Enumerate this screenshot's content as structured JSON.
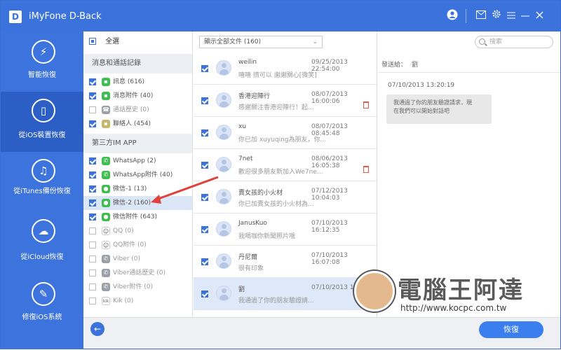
{
  "app": {
    "logo": "D",
    "title": "iMyFone D-Back"
  },
  "titlebar_icons": [
    "user-icon",
    "mail-icon",
    "gear-icon",
    "menu-icon",
    "minimize-icon",
    "close-icon"
  ],
  "sidebar": {
    "items": [
      {
        "label": "智能恢復",
        "icon": "smart-recover-icon",
        "glyph": "⚡"
      },
      {
        "label": "從iOS裝置恢復",
        "icon": "ios-device-icon",
        "glyph": "▯"
      },
      {
        "label": "從iTunes備份恢復",
        "icon": "itunes-icon",
        "glyph": "♫"
      },
      {
        "label": "從iCloud恢復",
        "icon": "icloud-icon",
        "glyph": "☁"
      },
      {
        "label": "修復iOS系統",
        "icon": "repair-icon",
        "glyph": "✎"
      }
    ]
  },
  "categories": {
    "all_label": "全選",
    "section1": "消息和通話記錄",
    "section2": "第三方IM APP",
    "items1": [
      {
        "label": "訊息 (616)",
        "icon": "messages-icon"
      },
      {
        "label": "消息附件 (40)",
        "icon": "message-attachment-icon"
      },
      {
        "label": "通話歷史 (0)",
        "icon": "call-history-icon"
      },
      {
        "label": "聯絡人 (454)",
        "icon": "contacts-icon"
      }
    ],
    "items2": [
      {
        "label": "WhatsApp (2)",
        "icon": "whatsapp-icon"
      },
      {
        "label": "WhatsApp附件 (40)",
        "icon": "whatsapp-attachment-icon"
      },
      {
        "label": "微信-1 (13)",
        "icon": "wechat-icon"
      },
      {
        "label": "微信-2 (160)",
        "icon": "wechat-icon"
      },
      {
        "label": "微信附件 (643)",
        "icon": "wechat-attachment-icon"
      },
      {
        "label": "QQ (0)",
        "icon": "qq-icon"
      },
      {
        "label": "QQ附件 (0)",
        "icon": "qq-attachment-icon"
      },
      {
        "label": "Viber (0)",
        "icon": "viber-icon"
      },
      {
        "label": "Viber通話歷史 (0)",
        "icon": "viber-call-icon"
      },
      {
        "label": "Viber附件 (0)",
        "icon": "viber-attachment-icon"
      },
      {
        "label": "Kik (0)",
        "icon": "kik-icon"
      }
    ]
  },
  "list": {
    "filter": "顯示全部文件 (160)",
    "messages": [
      {
        "name": "weilin",
        "time": "09/25/2013 22:54:00",
        "preview": "嘻嘻 擠可以 謝謝關心[微笑]",
        "trash": false
      },
      {
        "name": "香港迎陣行",
        "time": "08/07/2013 16:00:06",
        "preview": "感謝關注香港迎陣行！起...",
        "trash": true
      },
      {
        "name": "xu",
        "time": "08/07/2013 08:45:48",
        "preview": "你已加 xuyuqing為朋友，你...",
        "trash": false
      },
      {
        "name": "7net",
        "time": "08/06/2013 16:05:38",
        "preview": "歡迎很多朋友新加入We7ne...",
        "trash": true
      },
      {
        "name": "賣女孩的小火材",
        "time": "07/12/2013 10:04:03",
        "preview": "你已加賣女孩的小火材為...",
        "trash": false
      },
      {
        "name": "JanusKuo",
        "time": "07/10/2013 16:12:35",
        "preview": "我喝咖你新聞照片哦",
        "trash": false
      },
      {
        "name": "丹尼爾",
        "time": "07/10/2013 16:07:08",
        "preview": "很有印象",
        "trash": false
      },
      {
        "name": "劉",
        "time": "07/10/2013 13:...",
        "preview": "我通過了你的朋友驗證請...",
        "trash": false
      }
    ]
  },
  "detail": {
    "search_placeholder": "搜索",
    "recipient_label": "發送給：",
    "recipient_name": "劉",
    "timestamp": "07/10/2013 13:20:19",
    "bubble_line1": "我通過了你的朋友驗證請求，現",
    "bubble_line2": "在我們可以開始對話吧"
  },
  "bottom": {
    "back_glyph": "←",
    "recover_label": "恢復"
  },
  "watermark": {
    "brand": "電腦王阿達",
    "url": "http://www.kocpc.com.tw"
  },
  "colors": {
    "accent": "#3b72dc",
    "annotation_arrow": "#e0423a"
  }
}
